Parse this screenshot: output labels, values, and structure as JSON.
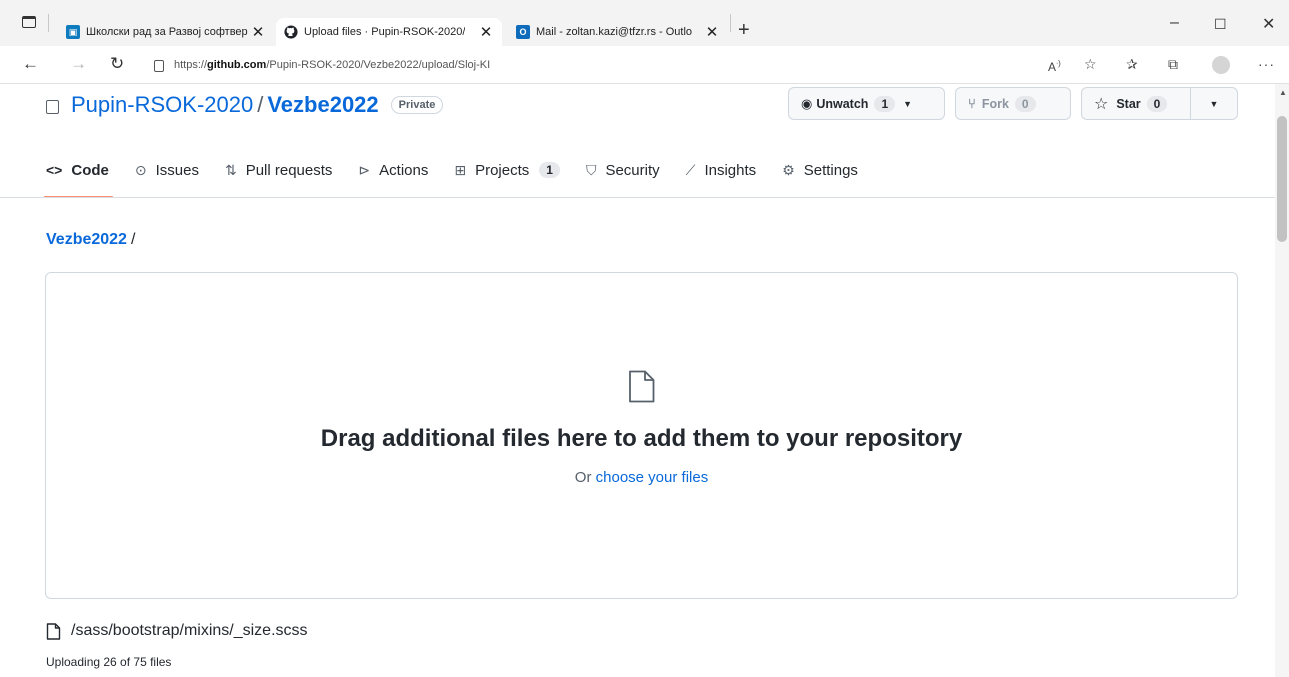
{
  "browser": {
    "tabs": [
      {
        "title": "Школски рад за Развој софтвер",
        "active": false
      },
      {
        "title": "Upload files · Pupin-RSOK-2020/",
        "active": true
      },
      {
        "title": "Mail - zoltan.kazi@tfzr.rs - Outlo",
        "active": false
      }
    ],
    "url_prefix": "https://",
    "url_host": "github.com",
    "url_path": "/Pupin-RSOK-2020/Vezbe2022/upload/Sloj-KI"
  },
  "repo": {
    "owner": "Pupin-RSOK-2020",
    "separator": "/",
    "name": "Vezbe2022",
    "visibility": "Private",
    "unwatch_label": "Unwatch",
    "unwatch_count": "1",
    "fork_label": "Fork",
    "fork_count": "0",
    "star_label": "Star",
    "star_count": "0"
  },
  "nav": {
    "code": "Code",
    "issues": "Issues",
    "pulls": "Pull requests",
    "actions": "Actions",
    "projects": "Projects",
    "projects_count": "1",
    "security": "Security",
    "insights": "Insights",
    "settings": "Settings"
  },
  "upload": {
    "breadcrumb_repo": "Vezbe2022",
    "breadcrumb_sep": "/",
    "title": "Drag additional files here to add them to your repository",
    "subtitle_prefix": "Or ",
    "subtitle_link": "choose your files",
    "current_file": "/sass/bootstrap/mixins/_size.scss",
    "status": "Uploading 26 of 75 files"
  },
  "colors": {
    "link": "#0969da",
    "active_tab_underline": "#fd8c73",
    "border": "#d0d7de"
  }
}
